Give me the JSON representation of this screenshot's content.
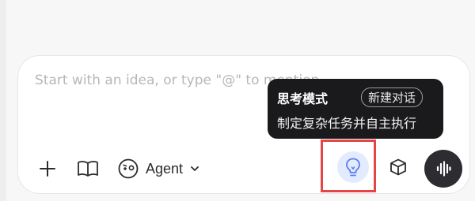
{
  "composer": {
    "placeholder": "Start with an idea, or type \"@\" to mention"
  },
  "toolbar": {
    "agent_label": "Agent"
  },
  "tooltip": {
    "title": "思考模式",
    "badge": "新建对话",
    "description": "制定复杂任务并自主执行"
  },
  "icons": {
    "plus": "plus-icon",
    "book": "book-open-icon",
    "agent": "agent-face-icon",
    "chevron": "chevron-down-icon",
    "think": "lightbulb-icon",
    "model": "cube-icon",
    "voice": "voice-wave-icon"
  },
  "colors": {
    "highlight": "#e54545",
    "think_bg": "#e3ebff",
    "think_icon": "#5b7cf5",
    "voice_bg": "#2d2d31",
    "tooltip_bg": "#1a1a1c"
  }
}
